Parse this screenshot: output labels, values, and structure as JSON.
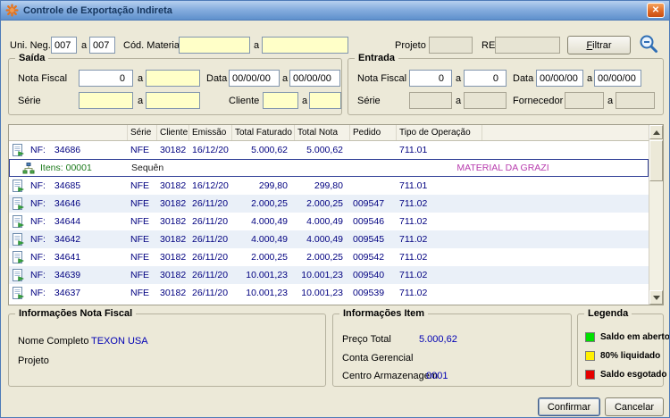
{
  "window": {
    "title": "Controle de Exportação Indireta",
    "close_glyph": "✕"
  },
  "range_separator": "a",
  "filter_bar": {
    "uni_neg_label": "Uni. Neg.",
    "uni_neg_from": "007",
    "uni_neg_to": "007",
    "cod_material_label": "Cód. Material",
    "cod_material_from": "",
    "cod_material_to": "",
    "projeto_label": "Projeto",
    "projeto_value": "",
    "re_label": "RE",
    "re_value": "",
    "filtrar_button": "Filtrar"
  },
  "saida": {
    "title": "Saída",
    "nota_fiscal_label": "Nota Fiscal",
    "nota_fiscal_from": "0",
    "nota_fiscal_to": "",
    "data_label": "Data",
    "data_from": "00/00/00",
    "data_to": "00/00/00",
    "serie_label": "Série",
    "serie_from": "",
    "serie_to": "",
    "cliente_label": "Cliente",
    "cliente_from": "",
    "cliente_to": ""
  },
  "entrada": {
    "title": "Entrada",
    "nota_fiscal_label": "Nota Fiscal",
    "nota_fiscal_from": "0",
    "nota_fiscal_to": "0",
    "data_label": "Data",
    "data_from": "00/00/00",
    "data_to": "00/00/00",
    "serie_label": "Série",
    "serie_from": "",
    "serie_to": "",
    "fornecedor_label": "Fornecedor",
    "fornecedor_from": "",
    "fornecedor_to": ""
  },
  "table": {
    "nf_label": "NF:",
    "headers": [
      "Série",
      "Cliente",
      "Emissão",
      "Total Faturado",
      "Total Nota",
      "Pedido",
      "Tipo de Operação"
    ],
    "rows": [
      {
        "kind": "nf",
        "nf": "34686",
        "serie": "NFE",
        "cliente": "30182",
        "emissao": "16/12/20",
        "total_faturado": "5.000,62",
        "total_nota": "5.000,62",
        "pedido": "",
        "tipo_operacao": "711.01"
      },
      {
        "kind": "itens",
        "itens": "Itens: 00001",
        "sequencia": "Sequên",
        "material": "MATERIAL DA GRAZI",
        "selected": true
      },
      {
        "kind": "nf",
        "nf": "34685",
        "serie": "NFE",
        "cliente": "30182",
        "emissao": "16/12/20",
        "total_faturado": "299,80",
        "total_nota": "299,80",
        "pedido": "",
        "tipo_operacao": "711.01"
      },
      {
        "kind": "nf",
        "nf": "34646",
        "serie": "NFE",
        "cliente": "30182",
        "emissao": "26/11/20",
        "total_faturado": "2.000,25",
        "total_nota": "2.000,25",
        "pedido": "009547",
        "tipo_operacao": "711.02"
      },
      {
        "kind": "nf",
        "nf": "34644",
        "serie": "NFE",
        "cliente": "30182",
        "emissao": "26/11/20",
        "total_faturado": "4.000,49",
        "total_nota": "4.000,49",
        "pedido": "009546",
        "tipo_operacao": "711.02"
      },
      {
        "kind": "nf",
        "nf": "34642",
        "serie": "NFE",
        "cliente": "30182",
        "emissao": "26/11/20",
        "total_faturado": "4.000,49",
        "total_nota": "4.000,49",
        "pedido": "009545",
        "tipo_operacao": "711.02"
      },
      {
        "kind": "nf",
        "nf": "34641",
        "serie": "NFE",
        "cliente": "30182",
        "emissao": "26/11/20",
        "total_faturado": "2.000,25",
        "total_nota": "2.000,25",
        "pedido": "009542",
        "tipo_operacao": "711.02"
      },
      {
        "kind": "nf",
        "nf": "34639",
        "serie": "NFE",
        "cliente": "30182",
        "emissao": "26/11/20",
        "total_faturado": "10.001,23",
        "total_nota": "10.001,23",
        "pedido": "009540",
        "tipo_operacao": "711.02"
      },
      {
        "kind": "nf",
        "nf": "34637",
        "serie": "NFE",
        "cliente": "30182",
        "emissao": "26/11/20",
        "total_faturado": "10.001,23",
        "total_nota": "10.001,23",
        "pedido": "009539",
        "tipo_operacao": "711.02"
      }
    ]
  },
  "info_nota_fiscal": {
    "title": "Informações Nota Fiscal",
    "nome_completo_label": "Nome Completo",
    "nome_completo_value": "TEXON USA",
    "projeto_label": "Projeto",
    "projeto_value": ""
  },
  "info_item": {
    "title": "Informações Item",
    "preco_total_label": "Preço Total",
    "preco_total_value": "5.000,62",
    "conta_gerencial_label": "Conta Gerencial",
    "conta_gerencial_value": "",
    "centro_armazenagem_label": "Centro Armazenagem",
    "centro_armazenagem_value": "0001"
  },
  "legenda": {
    "title": "Legenda",
    "items": [
      {
        "color": "#00E000",
        "label": "Saldo em aberto"
      },
      {
        "color": "#FFF000",
        "label": "80% liquidado"
      },
      {
        "color": "#E60000",
        "label": "Saldo esgotado"
      }
    ]
  },
  "footer": {
    "confirmar_button": "Confirmar",
    "cancelar_button": "Cancelar"
  }
}
